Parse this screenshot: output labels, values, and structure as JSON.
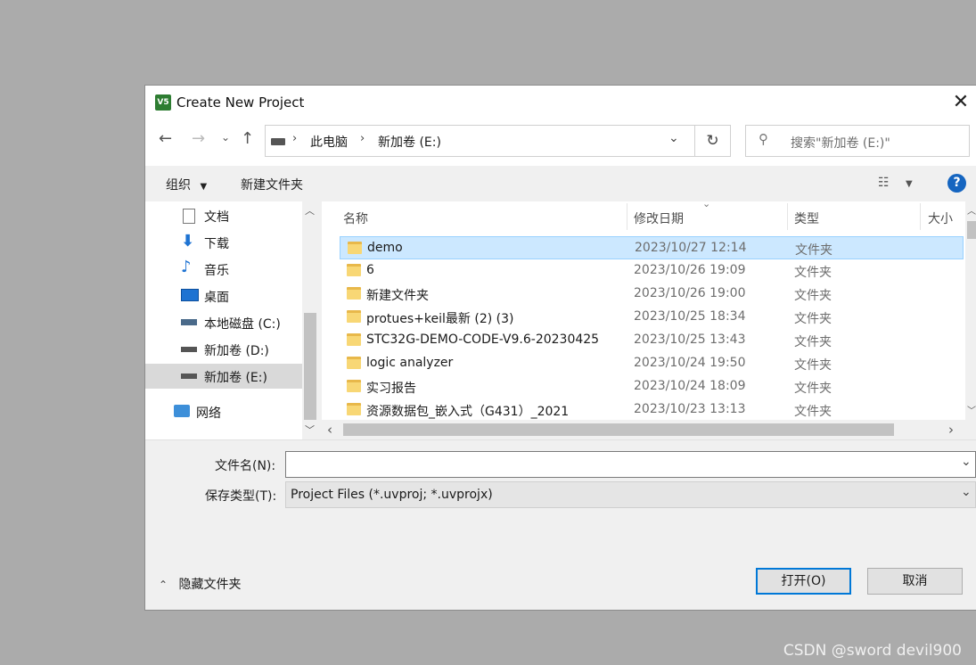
{
  "window": {
    "title": "Create New Project",
    "app_icon_text": "V5"
  },
  "address": {
    "crumbs": [
      "此电脑",
      "新加卷 (E:)"
    ]
  },
  "search": {
    "placeholder": "搜索\"新加卷 (E:)\""
  },
  "toolbar": {
    "organize": "组织",
    "new_folder": "新建文件夹"
  },
  "nav": [
    {
      "label": "文档",
      "icon": "document-icon"
    },
    {
      "label": "下载",
      "icon": "download-icon"
    },
    {
      "label": "音乐",
      "icon": "music-icon"
    },
    {
      "label": "桌面",
      "icon": "desktop-icon"
    },
    {
      "label": "本地磁盘 (C:)",
      "icon": "drive-icon"
    },
    {
      "label": "新加卷 (D:)",
      "icon": "drive-icon"
    },
    {
      "label": "新加卷 (E:)",
      "icon": "drive-icon",
      "selected": true
    },
    {
      "label": "网络",
      "icon": "network-icon"
    }
  ],
  "columns": {
    "name": "名称",
    "modified": "修改日期",
    "type": "类型",
    "size": "大小"
  },
  "files": [
    {
      "name": "demo",
      "modified": "2023/10/27 12:14",
      "type": "文件夹",
      "selected": true
    },
    {
      "name": "6",
      "modified": "2023/10/26 19:09",
      "type": "文件夹"
    },
    {
      "name": "新建文件夹",
      "modified": "2023/10/26 19:00",
      "type": "文件夹"
    },
    {
      "name": "protues+keil最新 (2) (3)",
      "modified": "2023/10/25 18:34",
      "type": "文件夹"
    },
    {
      "name": "STC32G-DEMO-CODE-V9.6-20230425",
      "modified": "2023/10/25 13:43",
      "type": "文件夹"
    },
    {
      "name": "logic analyzer",
      "modified": "2023/10/24 19:50",
      "type": "文件夹"
    },
    {
      "name": "实习报告",
      "modified": "2023/10/24 18:09",
      "type": "文件夹"
    },
    {
      "name": "资源数据包_嵌入式（G431）_2021",
      "modified": "2023/10/23 13:13",
      "type": "文件夹"
    }
  ],
  "form": {
    "filename_label": "文件名(N):",
    "filename_value": "",
    "filetype_label": "保存类型(T):",
    "filetype_value": "Project Files (*.uvproj; *.uvprojx)"
  },
  "footer": {
    "hide_folders": "隐藏文件夹",
    "open_button": "打开(O)",
    "cancel_button": "取消"
  },
  "watermark": "CSDN @sword devil900",
  "colors": {
    "selection": "#cce8ff",
    "accent": "#0078d7",
    "folder": "#f8d775",
    "help": "#1565c0"
  }
}
